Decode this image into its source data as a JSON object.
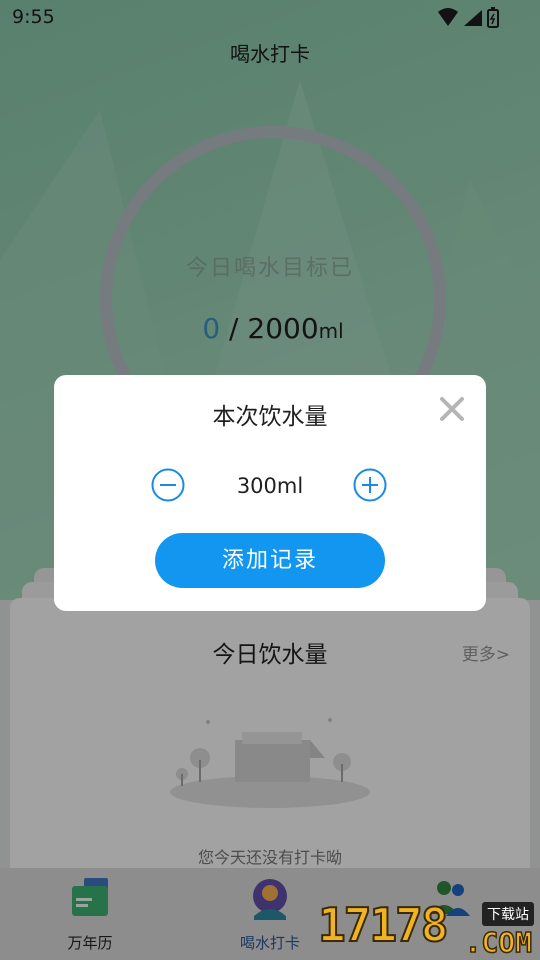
{
  "status": {
    "time": "9:55"
  },
  "header": {
    "title": "喝水打卡"
  },
  "ring": {
    "label": "今日喝水目标已",
    "current": "0",
    "separator": " / ",
    "goal": "2000",
    "unit": "ml"
  },
  "today_card": {
    "title": "今日饮水量",
    "more": "更多>",
    "empty_text": "您今天还没有打卡呦"
  },
  "tabbar": {
    "items": [
      {
        "label": "万年历"
      },
      {
        "label": "喝水打卡"
      },
      {
        "label": ""
      }
    ]
  },
  "dialog": {
    "title": "本次饮水量",
    "amount": "300ml",
    "confirm_label": "添加记录"
  },
  "watermark": {
    "number": "17178",
    "badge": "下载站",
    "suffix": ".COM"
  },
  "colors": {
    "accent": "#1296f0",
    "bg_green": "#8cc0a6",
    "watermark": "#f0b323"
  }
}
